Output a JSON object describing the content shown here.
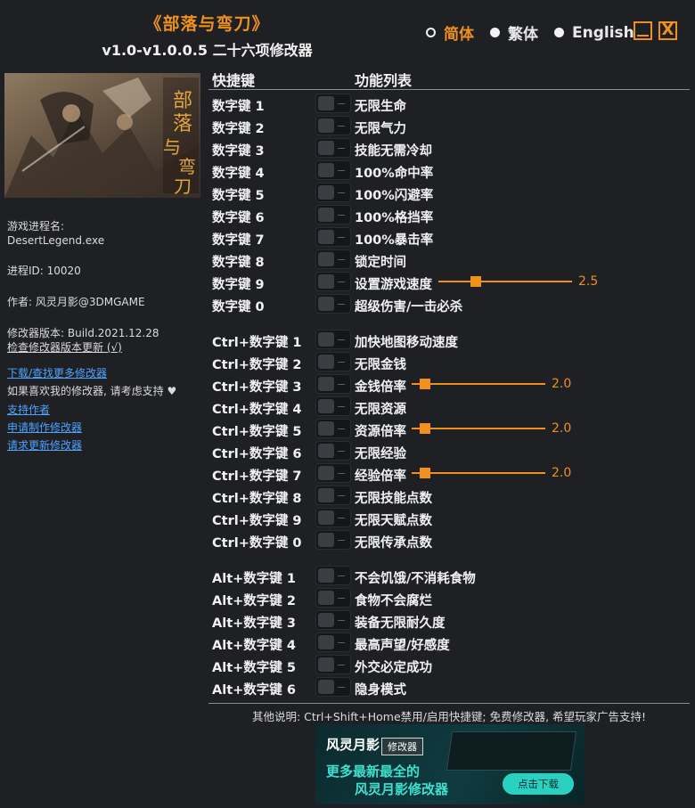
{
  "title": {
    "main": "《部落与弯刀》",
    "sub": "v1.0-v1.0.0.5 二十六项修改器"
  },
  "languages": [
    {
      "label": "简体",
      "active": true
    },
    {
      "label": "繁体",
      "active": false
    },
    {
      "label": "English",
      "active": false
    }
  ],
  "window": {
    "minimize": "_",
    "close": "X"
  },
  "cover": {
    "text": "部落与弯刀"
  },
  "sidebar": {
    "process_label": "游戏进程名:",
    "process_name": "DesertLegend.exe",
    "pid": "进程ID: 10020",
    "author": "作者: 风灵月影@3DMGAME",
    "version": "修改器版本: Build.2021.12.28",
    "check_update": "检查修改器版本更新 (√)",
    "download_link": "下载/查找更多修改器",
    "support_text": "如果喜欢我的修改器, 请考虑支持 ♥",
    "support_link": "支持作者",
    "request_make": "申请制作修改器",
    "request_update": "请求更新修改器"
  },
  "headers": {
    "hotkey": "快捷键",
    "function": "功能列表"
  },
  "groups": [
    [
      {
        "key": "数字键 1",
        "func": "无限生命"
      },
      {
        "key": "数字键 2",
        "func": "无限气力"
      },
      {
        "key": "数字键 3",
        "func": "技能无需冷却"
      },
      {
        "key": "数字键 4",
        "func": "100%命中率"
      },
      {
        "key": "数字键 5",
        "func": "100%闪避率"
      },
      {
        "key": "数字键 6",
        "func": "100%格挡率"
      },
      {
        "key": "数字键 7",
        "func": "100%暴击率"
      },
      {
        "key": "数字键 8",
        "func": "锁定时间"
      },
      {
        "key": "数字键 9",
        "func": "设置游戏速度",
        "slider": {
          "value": "2.5",
          "fraction": 0.28
        }
      },
      {
        "key": "数字键 0",
        "func": "超级伤害/一击必杀"
      }
    ],
    [
      {
        "key": "Ctrl+数字键 1",
        "func": "加快地图移动速度"
      },
      {
        "key": "Ctrl+数字键 2",
        "func": "无限金钱"
      },
      {
        "key": "Ctrl+数字键 3",
        "func": "金钱倍率",
        "slider": {
          "value": "2.0",
          "fraction": 0.1
        }
      },
      {
        "key": "Ctrl+数字键 4",
        "func": "无限资源"
      },
      {
        "key": "Ctrl+数字键 5",
        "func": "资源倍率",
        "slider": {
          "value": "2.0",
          "fraction": 0.1
        }
      },
      {
        "key": "Ctrl+数字键 6",
        "func": "无限经验"
      },
      {
        "key": "Ctrl+数字键 7",
        "func": "经验倍率",
        "slider": {
          "value": "2.0",
          "fraction": 0.1
        }
      },
      {
        "key": "Ctrl+数字键 8",
        "func": "无限技能点数"
      },
      {
        "key": "Ctrl+数字键 9",
        "func": "无限天赋点数"
      },
      {
        "key": "Ctrl+数字键 0",
        "func": "无限传承点数"
      }
    ],
    [
      {
        "key": "Alt+数字键 1",
        "func": "不会饥饿/不消耗食物"
      },
      {
        "key": "Alt+数字键 2",
        "func": "食物不会腐烂"
      },
      {
        "key": "Alt+数字键 3",
        "func": "装备无限耐久度"
      },
      {
        "key": "Alt+数字键 4",
        "func": "最高声望/好感度"
      },
      {
        "key": "Alt+数字键 5",
        "func": "外交必定成功"
      },
      {
        "key": "Alt+数字键 6",
        "func": "隐身模式"
      }
    ]
  ],
  "footer": {
    "note": "其他说明: Ctrl+Shift+Home禁用/启用快捷键; 免费修改器, 希望玩家广告支持!"
  },
  "ad": {
    "logo": "风灵月影",
    "tag": "修改器",
    "line1": "更多最新最全的",
    "line2": "风灵月影修改器",
    "button": "点击下载"
  },
  "colors": {
    "accent": "#f0901e",
    "link": "#4ea3ff",
    "background": "#1f2024"
  }
}
